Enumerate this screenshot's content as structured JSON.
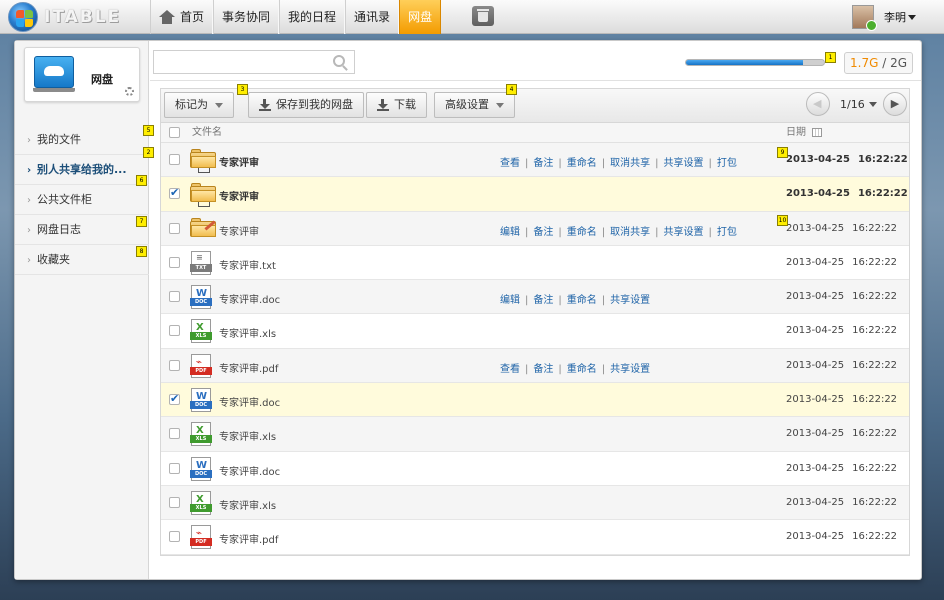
{
  "topbar": {
    "logo_text": "ITABLE",
    "nav": [
      {
        "label": "首页",
        "active": false
      },
      {
        "label": "事务协同",
        "active": false
      },
      {
        "label": "我的日程",
        "active": false
      },
      {
        "label": "通讯录",
        "active": false
      },
      {
        "label": "网盘",
        "active": true
      }
    ],
    "user_name": "李明"
  },
  "sidebar": {
    "card_title": "网盘",
    "items": [
      {
        "label": "我的文件",
        "active": false
      },
      {
        "label": "别人共享给我的...",
        "active": true
      },
      {
        "label": "公共文件柜",
        "active": false
      },
      {
        "label": "网盘日志",
        "active": false
      },
      {
        "label": "收藏夹",
        "active": false
      }
    ]
  },
  "search": {
    "placeholder": ""
  },
  "quota": {
    "used": "1.7G",
    "sep": " / ",
    "total": "2G",
    "used_fraction": 0.85
  },
  "toolbar": {
    "mark_label": "标记为",
    "save_label": "保存到我的网盘",
    "download_label": "下载",
    "advanced_label": "高级设置",
    "page_text": "1/16"
  },
  "table": {
    "col_name": "文件名",
    "col_date": "日期"
  },
  "badges": [
    "1",
    "2",
    "3",
    "4",
    "5",
    "6",
    "7",
    "8",
    "9",
    "10"
  ],
  "files": [
    {
      "name": "专家评审",
      "type": "folder-shared",
      "checked": false,
      "bold": true,
      "selected": false,
      "date": "2013-04-25",
      "time": "16:22:22",
      "actions": [
        "查看",
        "备注",
        "重命名",
        "取消共享",
        "共享设置",
        "打包"
      ]
    },
    {
      "name": "专家评审",
      "type": "folder-shared",
      "checked": true,
      "bold": true,
      "selected": true,
      "date": "2013-04-25",
      "time": "16:22:22",
      "actions": []
    },
    {
      "name": "专家评审",
      "type": "folder-edit",
      "checked": false,
      "bold": false,
      "selected": false,
      "date": "2013-04-25",
      "time": "16:22:22",
      "actions": [
        "编辑",
        "备注",
        "重命名",
        "取消共享",
        "共享设置",
        "打包"
      ]
    },
    {
      "name": "专家评审.txt",
      "type": "txt",
      "checked": false,
      "bold": false,
      "selected": false,
      "date": "2013-04-25",
      "time": "16:22:22",
      "actions": []
    },
    {
      "name": "专家评审.doc",
      "type": "doc-edit",
      "checked": false,
      "bold": false,
      "selected": false,
      "date": "2013-04-25",
      "time": "16:22:22",
      "actions": [
        "编辑",
        "备注",
        "重命名",
        "共享设置"
      ]
    },
    {
      "name": "专家评审.xls",
      "type": "xls",
      "checked": false,
      "bold": false,
      "selected": false,
      "date": "2013-04-25",
      "time": "16:22:22",
      "actions": []
    },
    {
      "name": "专家评审.pdf",
      "type": "pdf",
      "checked": false,
      "bold": false,
      "selected": false,
      "date": "2013-04-25",
      "time": "16:22:22",
      "actions": [
        "查看",
        "备注",
        "重命名",
        "共享设置"
      ]
    },
    {
      "name": "专家评审.doc",
      "type": "doc",
      "checked": true,
      "bold": false,
      "selected": true,
      "date": "2013-04-25",
      "time": "16:22:22",
      "actions": []
    },
    {
      "name": "专家评审.xls",
      "type": "xls",
      "checked": false,
      "bold": false,
      "selected": false,
      "date": "2013-04-25",
      "time": "16:22:22",
      "actions": []
    },
    {
      "name": "专家评审.doc",
      "type": "doc",
      "checked": false,
      "bold": false,
      "selected": false,
      "date": "2013-04-25",
      "time": "16:22:22",
      "actions": []
    },
    {
      "name": "专家评审.xls",
      "type": "xls",
      "checked": false,
      "bold": false,
      "selected": false,
      "date": "2013-04-25",
      "time": "16:22:22",
      "actions": []
    },
    {
      "name": "专家评审.pdf",
      "type": "pdf",
      "checked": false,
      "bold": false,
      "selected": false,
      "date": "2013-04-25",
      "time": "16:22:22",
      "actions": []
    }
  ],
  "colors": {
    "accent": "#f39b00",
    "link": "#1f64a8",
    "selected_row": "#fffbdc",
    "quota_used": "#f08a00"
  }
}
